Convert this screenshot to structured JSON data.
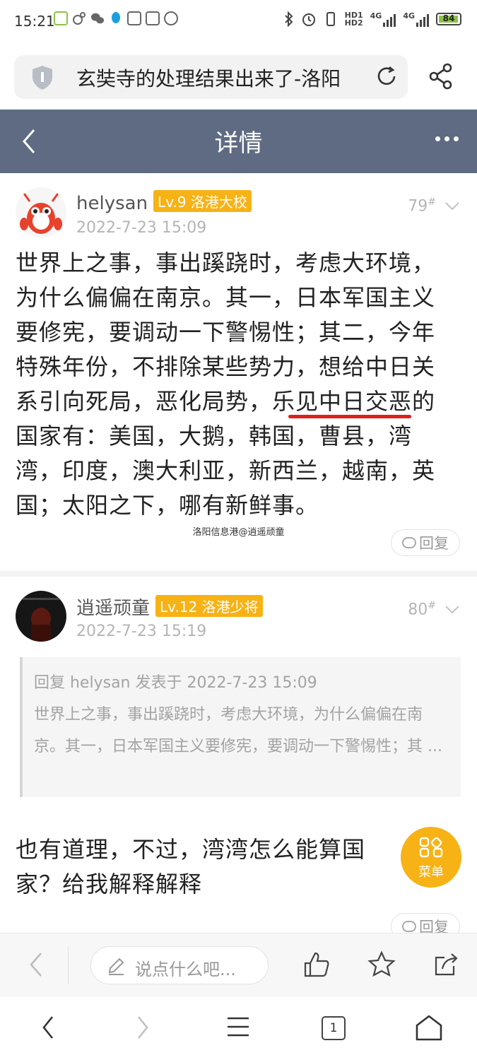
{
  "status_bar": {
    "time": "15:21",
    "network_1": "HD1",
    "network_2": "HD2",
    "signal_1": "4G",
    "signal_2": "4G",
    "battery": "84"
  },
  "browser": {
    "url_title": "玄奘寺的处理结果出来了-洛阳"
  },
  "header": {
    "title": "详情"
  },
  "posts": [
    {
      "username": "helysan",
      "level": "Lv.9 洛港大校",
      "date": "2022-7-23 15:09",
      "floor": "79",
      "floor_mark": "#",
      "body": "世界上之事，事出蹊跷时，考虑大环境，为什么偏偏在南京。其一，日本军国主义要修宪，要调动一下警惕性；其二，今年特殊年份，不排除某些势力，想给中日关系引向死局，恶化局势，乐见中日交恶的国家有：美国，大鹅，韩国，曹县，湾湾，印度，澳大利亚，新西兰，越南，英国；太阳之下，哪有新鲜事。",
      "watermark": "洛阳信息港@逍遥顽童",
      "reply_label": "回复"
    },
    {
      "username": "逍遥顽童",
      "level": "Lv.12 洛港少将",
      "date": "2022-7-23 15:19",
      "floor": "80",
      "floor_mark": "#",
      "quote_header": "回复 helysan 发表于 2022-7-23 15:09",
      "quote_body": "世界上之事，事出蹊跷时，考虑大环境，为什么偏偏在南京。其一，日本军国主义要修宪，要调动一下警惕性；其 ...",
      "body": "也有道理，不过，湾湾怎么能算国家？给我解释解释",
      "reply_label": "回复"
    }
  ],
  "fab": {
    "label": "菜单"
  },
  "comment_bar": {
    "placeholder": "说点什么吧..."
  },
  "nav_bar": {
    "tab_count": "1"
  },
  "colors": {
    "header_bg": "#5e6b82",
    "badge": "#f7b215",
    "underline": "#e0201a",
    "battery": "#8bc34a"
  }
}
